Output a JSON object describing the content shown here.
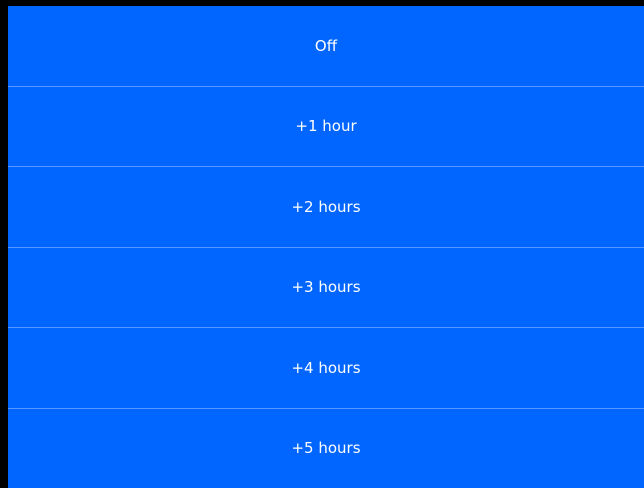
{
  "menu": {
    "options": [
      {
        "label": "Off"
      },
      {
        "label": "+1 hour"
      },
      {
        "label": "+2 hours"
      },
      {
        "label": "+3 hours"
      },
      {
        "label": "+4 hours"
      },
      {
        "label": "+5 hours"
      }
    ]
  },
  "colors": {
    "background": "#0066ff",
    "divider": "#5a96ff",
    "text": "#ffffff",
    "border": "#000000"
  }
}
